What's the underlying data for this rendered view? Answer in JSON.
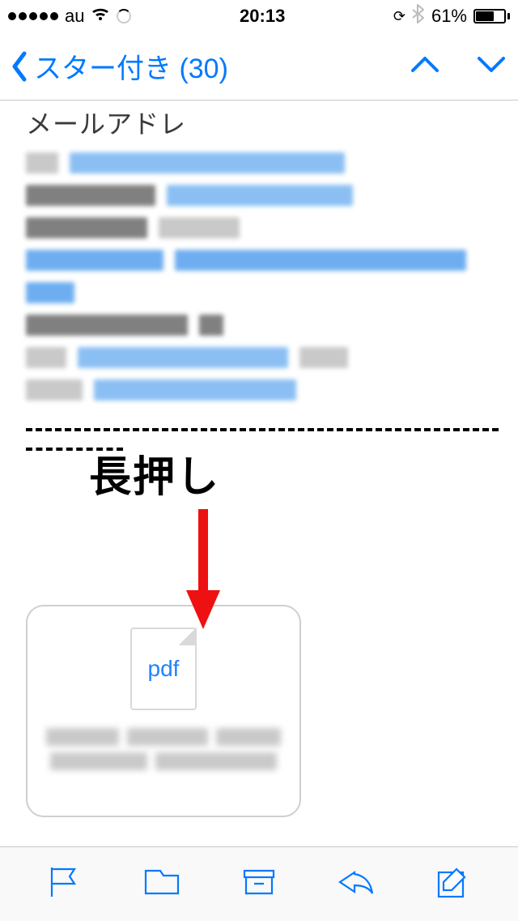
{
  "status": {
    "carrier": "au",
    "time": "20:13",
    "battery_pct": "61%"
  },
  "nav": {
    "back_label": "スター付き (30)"
  },
  "content": {
    "heading": "メールアドレ",
    "annotation": "長押し",
    "attachment": {
      "type_label": "pdf"
    }
  },
  "icons": {
    "back": "chevron-left",
    "up": "chevron-up",
    "down": "chevron-down",
    "flag": "flag",
    "folder": "folder",
    "archive": "archive",
    "reply": "reply",
    "compose": "compose"
  }
}
